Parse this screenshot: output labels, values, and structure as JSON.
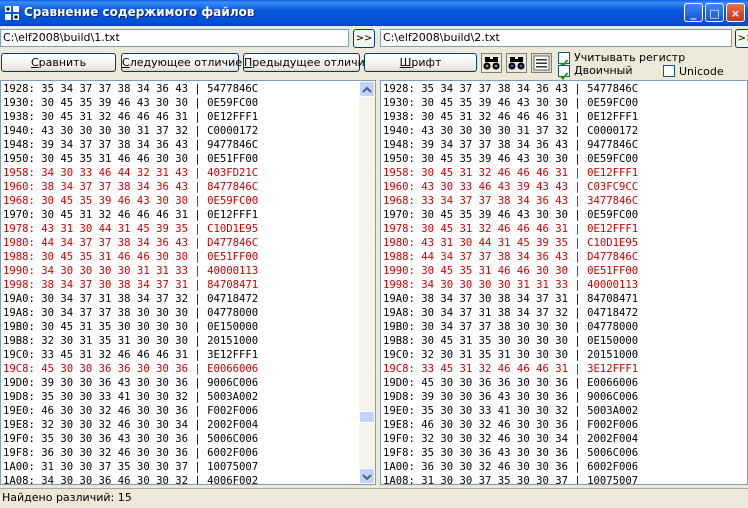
{
  "window": {
    "title": "Сравнение содержимого файлов",
    "minimize_glyph": "_",
    "maximize_glyph": "□",
    "close_glyph": "×"
  },
  "paths": {
    "left": "C:\\elf2008\\build\\1.txt",
    "right": "C:\\elf2008\\build\\2.txt",
    "go_label": ">>"
  },
  "toolbar": {
    "compare": {
      "underlined": "С",
      "rest": "равнить"
    },
    "next": {
      "underlined": "С",
      "rest": "ледующее отличие"
    },
    "prev": {
      "underlined": "П",
      "rest": "редыдущее отличие"
    },
    "font": {
      "underlined": "Ш",
      "rest": "рифт"
    }
  },
  "options": {
    "match_case": {
      "label": "Учитывать регистр",
      "checked": true
    },
    "binary": {
      "label": "Двоичный",
      "checked": true
    },
    "unicode": {
      "label": "Unicode",
      "checked": false
    }
  },
  "icons": [
    "binoculars-find-icon",
    "binoculars-find-next-icon",
    "compare-mode-icon"
  ],
  "colors": {
    "diff": "#cc0000",
    "title": "#0450d6"
  },
  "left_rows": [
    {
      "t": "1928: 35 34 37 37 38 34 36 43 | 5477846C",
      "d": false
    },
    {
      "t": "1930: 30 45 35 39 46 43 30 30 | 0E59FC00",
      "d": false
    },
    {
      "t": "1938: 30 45 31 32 46 46 46 31 | 0E12FFF1",
      "d": false
    },
    {
      "t": "1940: 43 30 30 30 30 31 37 32 | C0000172",
      "d": false
    },
    {
      "t": "1948: 39 34 37 37 38 34 36 43 | 9477846C",
      "d": false
    },
    {
      "t": "1950: 30 45 35 31 46 46 30 30 | 0E51FF00",
      "d": false
    },
    {
      "t": "1958: 34 30 33 46 44 32 31 43 | 403FD21C",
      "d": true
    },
    {
      "t": "1960: 38 34 37 37 38 34 36 43 | 8477846C",
      "d": true
    },
    {
      "t": "1968: 30 45 35 39 46 43 30 30 | 0E59FC00",
      "d": true
    },
    {
      "t": "1970: 30 45 31 32 46 46 46 31 | 0E12FFF1",
      "d": false
    },
    {
      "t": "1978: 43 31 30 44 31 45 39 35 | C10D1E95",
      "d": true
    },
    {
      "t": "1980: 44 34 37 37 38 34 36 43 | D477846C",
      "d": true
    },
    {
      "t": "1988: 30 45 35 31 46 46 30 30 | 0E51FF00",
      "d": true
    },
    {
      "t": "1990: 34 30 30 30 30 31 31 33 | 40000113",
      "d": true
    },
    {
      "t": "1998: 38 34 37 30 38 34 37 31 | 84708471",
      "d": true
    },
    {
      "t": "19A0: 30 34 37 31 38 34 37 32 | 04718472",
      "d": false
    },
    {
      "t": "19A8: 30 34 37 37 38 30 30 30 | 04778000",
      "d": false
    },
    {
      "t": "19B0: 30 45 31 35 30 30 30 30 | 0E150000",
      "d": false
    },
    {
      "t": "19B8: 32 30 31 35 31 30 30 30 | 20151000",
      "d": false
    },
    {
      "t": "19C0: 33 45 31 32 46 46 46 31 | 3E12FFF1",
      "d": false
    },
    {
      "t": "19C8: 45 30 30 36 36 30 30 36 | E0066006",
      "d": true
    },
    {
      "t": "19D0: 39 30 30 36 43 30 30 36 | 9006C006",
      "d": false
    },
    {
      "t": "19D8: 35 30 30 33 41 30 30 32 | 5003A002",
      "d": false
    },
    {
      "t": "19E0: 46 30 30 32 46 30 30 36 | F002F006",
      "d": false
    },
    {
      "t": "19E8: 32 30 30 32 46 30 30 34 | 2002F004",
      "d": false
    },
    {
      "t": "19F0: 35 30 30 36 43 30 30 36 | 5006C006",
      "d": false
    },
    {
      "t": "19F8: 36 30 30 32 46 30 30 36 | 6002F006",
      "d": false
    },
    {
      "t": "1A00: 31 30 30 37 35 30 30 37 | 10075007",
      "d": false
    },
    {
      "t": "1A08: 34 30 30 36 46 30 30 32 | 4006F002",
      "d": false
    }
  ],
  "right_rows": [
    {
      "t": "1928: 35 34 37 37 38 34 36 43 | 5477846C",
      "d": false
    },
    {
      "t": "1930: 30 45 35 39 46 43 30 30 | 0E59FC00",
      "d": false
    },
    {
      "t": "1938: 30 45 31 32 46 46 46 31 | 0E12FFF1",
      "d": false
    },
    {
      "t": "1940: 43 30 30 30 30 31 37 32 | C0000172",
      "d": false
    },
    {
      "t": "1948: 39 34 37 37 38 34 36 43 | 9477846C",
      "d": false
    },
    {
      "t": "1950: 30 45 35 39 46 43 30 30 | 0E59FC00",
      "d": false
    },
    {
      "t": "1958: 30 45 31 32 46 46 46 31 | 0E12FFF1",
      "d": true
    },
    {
      "t": "1960: 43 30 33 46 43 39 43 43 | C03FC9CC",
      "d": true
    },
    {
      "t": "1968: 33 34 37 37 38 34 36 43 | 3477846C",
      "d": true
    },
    {
      "t": "1970: 30 45 35 39 46 43 30 30 | 0E59FC00",
      "d": false
    },
    {
      "t": "1978: 30 45 31 32 46 46 46 31 | 0E12FFF1",
      "d": true
    },
    {
      "t": "1980: 43 31 30 44 31 45 39 35 | C10D1E95",
      "d": true
    },
    {
      "t": "1988: 44 34 37 37 38 34 36 43 | D477846C",
      "d": true
    },
    {
      "t": "1990: 30 45 35 31 46 46 30 30 | 0E51FF00",
      "d": true
    },
    {
      "t": "1998: 34 30 30 30 30 31 31 33 | 40000113",
      "d": true
    },
    {
      "t": "19A0: 38 34 37 30 38 34 37 31 | 84708471",
      "d": false
    },
    {
      "t": "19A8: 30 34 37 31 38 34 37 32 | 04718472",
      "d": false
    },
    {
      "t": "19B0: 30 34 37 37 38 30 30 30 | 04778000",
      "d": false
    },
    {
      "t": "19B8: 30 45 31 35 30 30 30 30 | 0E150000",
      "d": false
    },
    {
      "t": "19C0: 32 30 31 35 31 30 30 30 | 20151000",
      "d": false
    },
    {
      "t": "19C8: 33 45 31 32 46 46 46 31 | 3E12FFF1",
      "d": true
    },
    {
      "t": "19D0: 45 30 30 36 36 30 30 36 | E0066006",
      "d": false
    },
    {
      "t": "19D8: 39 30 30 36 43 30 30 36 | 9006C006",
      "d": false
    },
    {
      "t": "19E0: 35 30 30 33 41 30 30 32 | 5003A002",
      "d": false
    },
    {
      "t": "19E8: 46 30 30 32 46 30 30 36 | F002F006",
      "d": false
    },
    {
      "t": "19F0: 32 30 30 32 46 30 30 34 | 2002F004",
      "d": false
    },
    {
      "t": "19F8: 35 30 30 36 43 30 30 36 | 5006C006",
      "d": false
    },
    {
      "t": "1A00: 36 30 30 32 46 30 30 36 | 6002F006",
      "d": false
    },
    {
      "t": "1A08: 31 30 30 37 35 30 30 37 | 10075007",
      "d": false
    }
  ],
  "status": {
    "text": "Найдено различий: 15"
  }
}
